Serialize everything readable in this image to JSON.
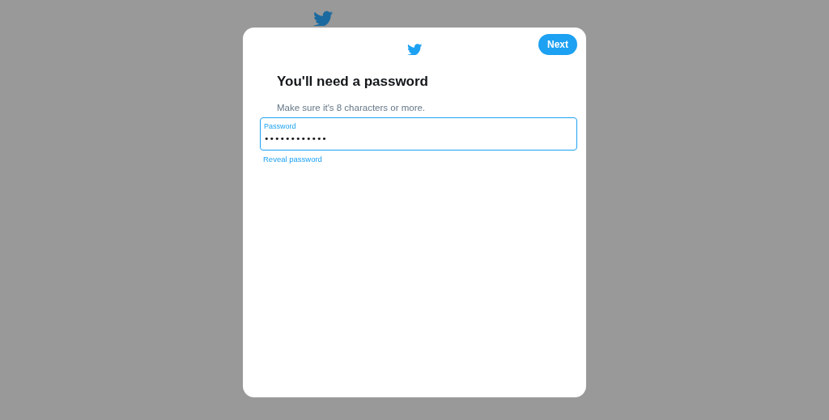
{
  "dialog": {
    "next_button": "Next",
    "title": "You'll need a password",
    "subtitle": "Make sure it's 8 characters or more.",
    "password_field": {
      "label": "Password",
      "value": "••••••••••••",
      "focused": true
    },
    "reveal_link": "Reveal password"
  }
}
